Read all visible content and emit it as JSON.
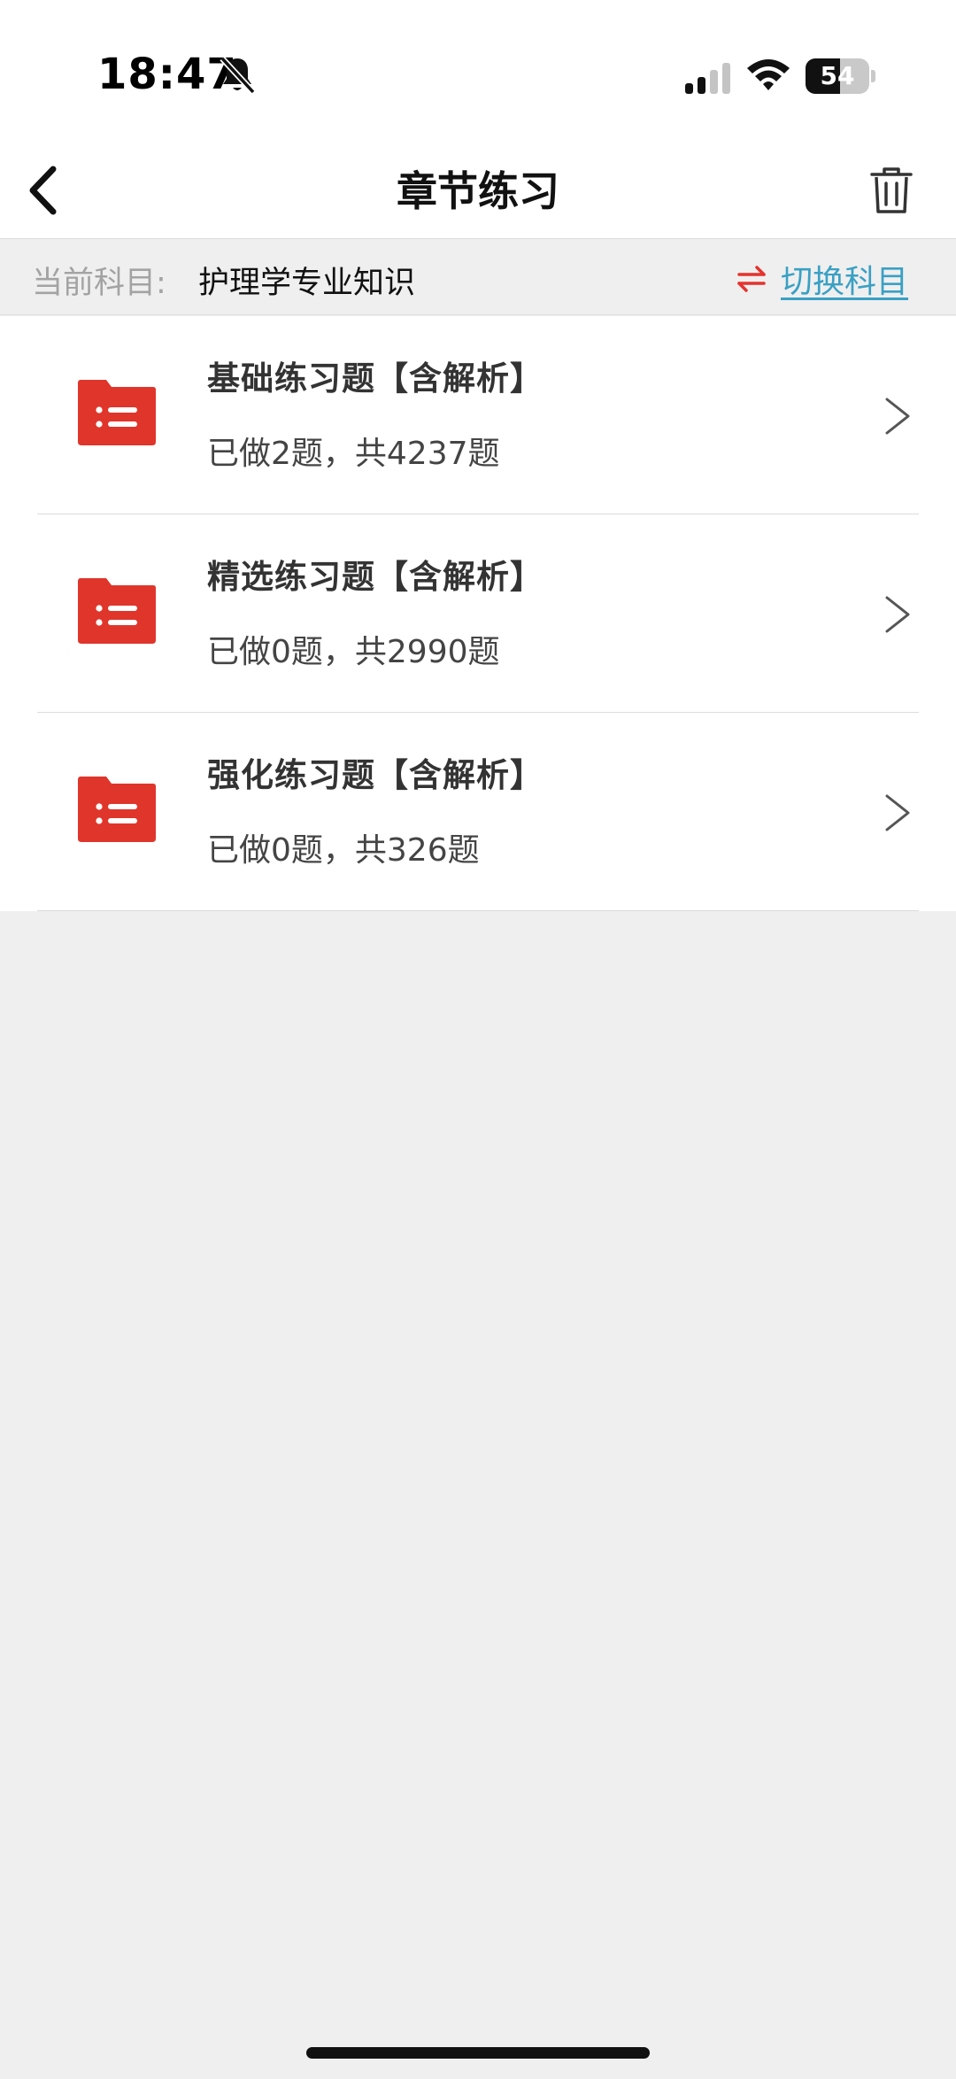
{
  "status_bar": {
    "time": "18:47",
    "battery": "54",
    "battery_level": 0.54
  },
  "nav": {
    "title": "章节练习"
  },
  "subject_bar": {
    "label": "当前科目:",
    "value": "护理学专业知识",
    "switch_label": "切换科目",
    "switch_color": "#e5322d",
    "link_color": "#3aa0c4"
  },
  "list": {
    "items": [
      {
        "title": "基础练习题【含解析】",
        "progress": "已做2题，共4237题",
        "icon": "folder-list-icon"
      },
      {
        "title": "精选练习题【含解析】",
        "progress": "已做0题，共2990题",
        "icon": "folder-list-icon"
      },
      {
        "title": "强化练习题【含解析】",
        "progress": "已做0题，共326题",
        "icon": "folder-list-icon"
      }
    ]
  },
  "colors": {
    "accent_red": "#e0352b",
    "background": "#efefef"
  }
}
